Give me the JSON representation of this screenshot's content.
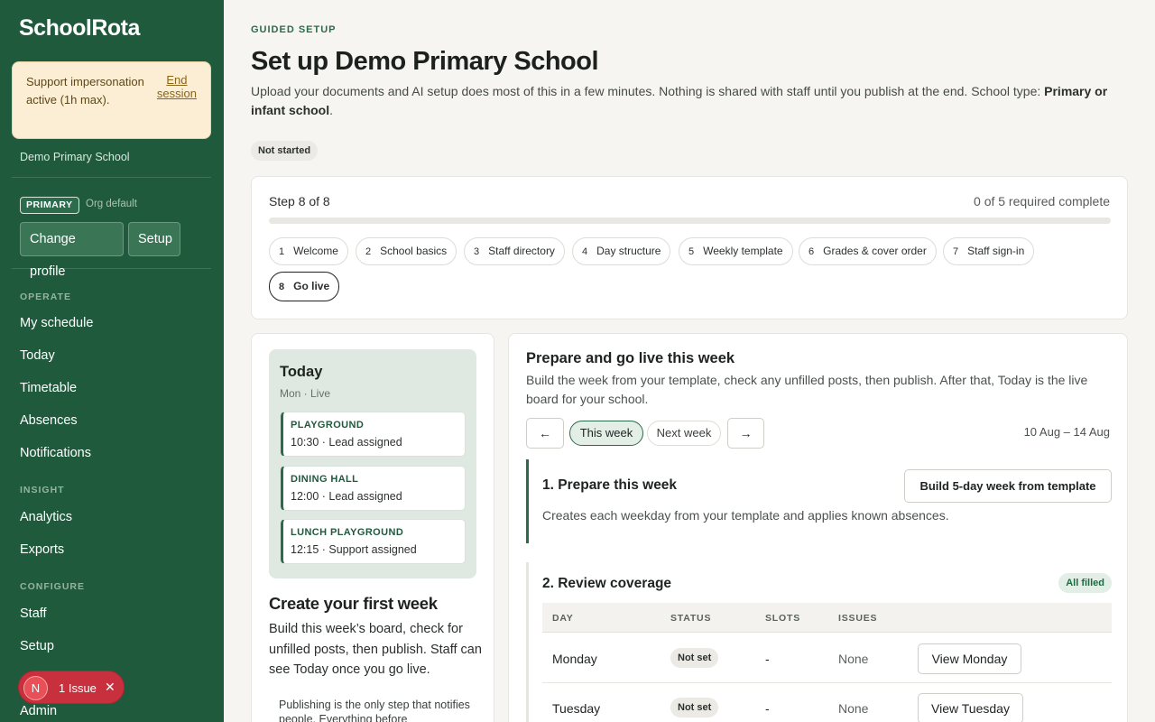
{
  "sidebar": {
    "logo": "SchoolRota",
    "impersonation": {
      "text": "Support impersonation active (1h max).",
      "end_label": "End session"
    },
    "school_name": "Demo Primary School",
    "profile_badge": "PRIMARY",
    "profile_note": "Org default",
    "change_profile_label": "Change profile",
    "setup_label": "Setup",
    "sections": {
      "operate": "OPERATE",
      "insight": "INSIGHT",
      "configure": "CONFIGURE"
    },
    "nav": {
      "my_schedule": "My schedule",
      "today": "Today",
      "timetable": "Timetable",
      "absences": "Absences",
      "notifications": "Notifications",
      "analytics": "Analytics",
      "exports": "Exports",
      "staff": "Staff",
      "setup": "Setup",
      "admin": "Admin"
    },
    "issue": {
      "avatar": "N",
      "label": "1 Issue"
    }
  },
  "header": {
    "eyebrow": "GUIDED SETUP",
    "title": "Set up Demo Primary School",
    "intro": "Upload your documents and AI setup does most of this in a few minutes. Nothing is shared with staff until you publish at the end. School type:",
    "school_type": "Primary or infant school",
    "status": "Not started"
  },
  "steps_card": {
    "step_label": "Step 8 of 8",
    "required": "0 of 5 required complete",
    "progress": 0,
    "steps": [
      {
        "num": "1",
        "label": "Welcome"
      },
      {
        "num": "2",
        "label": "School basics"
      },
      {
        "num": "3",
        "label": "Staff directory"
      },
      {
        "num": "4",
        "label": "Day structure"
      },
      {
        "num": "5",
        "label": "Weekly template"
      },
      {
        "num": "6",
        "label": "Grades & cover order"
      },
      {
        "num": "7",
        "label": "Staff sign-in"
      },
      {
        "num": "8",
        "label": "Go live"
      }
    ]
  },
  "preview": {
    "title": "Today",
    "subtitle": "Mon · Live",
    "slots": [
      {
        "place": "PLAYGROUND",
        "detail": "10:30 · Lead assigned"
      },
      {
        "place": "DINING HALL",
        "detail": "12:00 · Lead assigned"
      },
      {
        "place": "LUNCH PLAYGROUND",
        "detail": "12:15 · Support assigned"
      }
    ],
    "heading": "Create your first week",
    "body": "Build this week’s board, check for unfilled posts, then publish. Staff can see Today once you go live.",
    "note": "Publishing is the only step that notifies people. Everything before"
  },
  "golive": {
    "title": "Prepare and go live this week",
    "desc": "Build the week from your template, check any unfilled posts, then publish. After that, Today is the live board for your school.",
    "prev_icon": "←",
    "next_icon": "→",
    "this_week": "This week",
    "next_week": "Next week",
    "range": "10 Aug – 14 Aug",
    "prepare": {
      "title": "1. Prepare this week",
      "button": "Build 5-day week from template",
      "desc": "Creates each weekday from your template and applies known absences."
    },
    "review": {
      "title": "2. Review coverage",
      "badge": "All filled",
      "headers": [
        "DAY",
        "STATUS",
        "SLOTS",
        "ISSUES"
      ],
      "rows": [
        {
          "day": "Monday",
          "status": "Not set",
          "slots": "-",
          "issues": "None",
          "action": "View Monday"
        },
        {
          "day": "Tuesday",
          "status": "Not set",
          "slots": "-",
          "issues": "None",
          "action": "View Tuesday"
        }
      ]
    }
  },
  "colors": {
    "sidebar": "#1f5a3c",
    "accent": "#2d6a4a",
    "alert": "#c9303e"
  }
}
